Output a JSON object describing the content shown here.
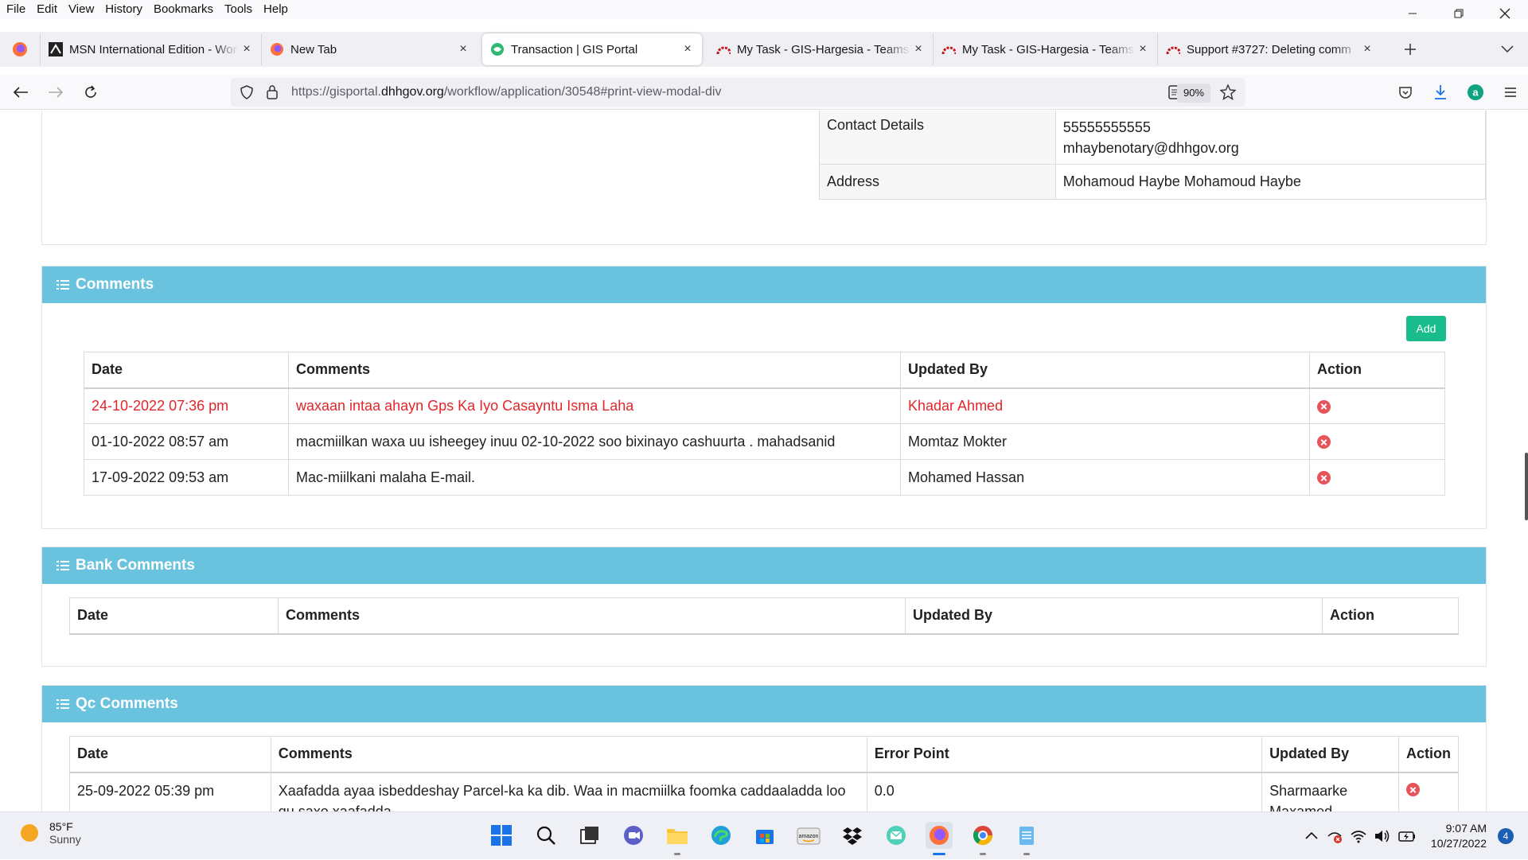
{
  "menubar": {
    "items": [
      "File",
      "Edit",
      "View",
      "History",
      "Bookmarks",
      "Tools",
      "Help"
    ]
  },
  "tabs": [
    {
      "title": "MSN International Edition - Wor",
      "icon": "msn-icon"
    },
    {
      "title": "New Tab",
      "icon": "firefox-icon"
    },
    {
      "title": "Transaction | GIS Portal",
      "icon": "gis-portal-icon",
      "active": true
    },
    {
      "title": "My Task - GIS-Hargesia - Teams",
      "icon": "redmine-icon"
    },
    {
      "title": "My Task - GIS-Hargesia - Teams",
      "icon": "redmine-icon"
    },
    {
      "title": "Support #3727: Deleting comm",
      "icon": "redmine-icon"
    }
  ],
  "navbar": {
    "url_prefix": "https://gisportal.",
    "url_domain": "dhhgov.org",
    "url_path": "/workflow/application/30548#print-view-modal-div",
    "zoom": "90%"
  },
  "owner_details": {
    "contact_label": "Contact Details",
    "contact_phone": "55555555555",
    "contact_email": "mhaybenotary@dhhgov.org",
    "address_label": "Address",
    "address_value": "Mohamoud Haybe Mohamoud Haybe"
  },
  "comments": {
    "title": "Comments",
    "add_label": "Add",
    "headers": [
      "Date",
      "Comments",
      "Updated By",
      "Action"
    ],
    "rows": [
      {
        "date": "24-10-2022 07:36 pm",
        "comment": "waxaan intaa ahayn Gps Ka Iyo Casayntu Isma Laha",
        "updated_by": "Khadar Ahmed",
        "highlight": true
      },
      {
        "date": "01-10-2022 08:57 am",
        "comment": "macmiilkan waxa uu isheegey inuu 02-10-2022 soo bixinayo cashuurta . mahadsanid",
        "updated_by": "Momtaz Mokter"
      },
      {
        "date": "17-09-2022 09:53 am",
        "comment": "Mac-miilkani malaha E-mail.",
        "updated_by": "Mohamed Hassan"
      }
    ]
  },
  "bank_comments": {
    "title": "Bank Comments",
    "headers": [
      "Date",
      "Comments",
      "Updated By",
      "Action"
    ]
  },
  "qc_comments": {
    "title": "Qc Comments",
    "headers": [
      "Date",
      "Comments",
      "Error Point",
      "Updated By",
      "Action"
    ],
    "rows": [
      {
        "date": "25-09-2022 05:39 pm",
        "comment": "Xaafadda ayaa isbeddeshay Parcel-ka ka dib. Waa in macmiilka foomka caddaaladda loo qu saxo xaafadda",
        "error_point": "0.0",
        "updated_by": "Sharmaarke Maxamed"
      }
    ]
  },
  "taskbar": {
    "weather_temp": "85°F",
    "weather_cond": "Sunny",
    "time": "9:07 AM",
    "date": "10/27/2022",
    "notifications": "4"
  },
  "colors": {
    "panel_header": "#69c3df",
    "add_button": "#1abc8c",
    "highlight_text": "#e3262b",
    "delete_icon": "#e8535a"
  }
}
